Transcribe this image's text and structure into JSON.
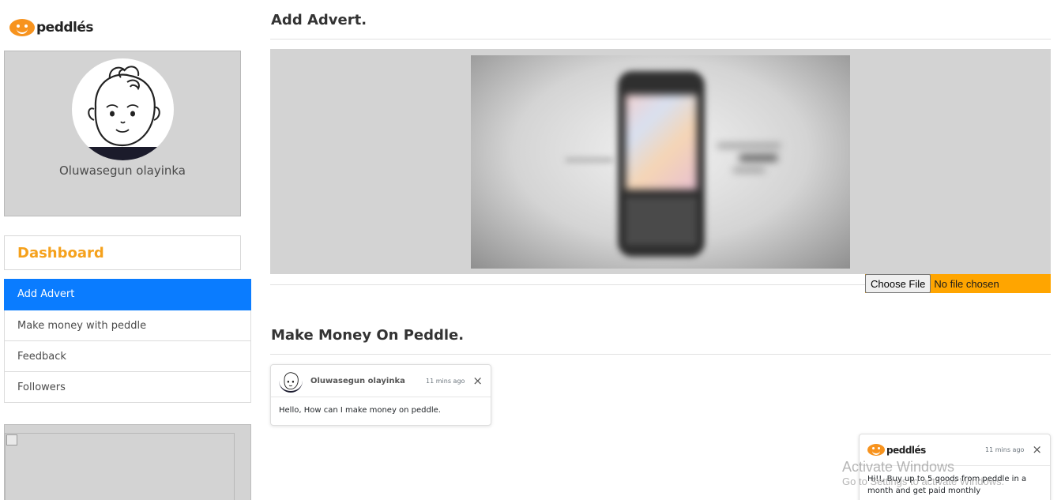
{
  "brand": {
    "logo_text": "peddlés",
    "accent": "#f5a11c",
    "active_blue": "#0a7cff"
  },
  "profile": {
    "name": "Oluwasegun olayinka"
  },
  "sidebar": {
    "dashboard_label": "Dashboard",
    "menu": [
      {
        "label": "Add Advert",
        "active": true
      },
      {
        "label": "Make money with peddle",
        "active": false
      },
      {
        "label": "Feedback",
        "active": false
      },
      {
        "label": "Followers",
        "active": false
      }
    ]
  },
  "main": {
    "add_advert_title": "Add Advert.",
    "file_input": {
      "button_label": "Choose File",
      "status": "No file chosen",
      "bar_color": "#ffa500"
    },
    "make_money_title": "Make Money On Peddle."
  },
  "toasts": [
    {
      "sender": "Oluwasegun olayinka",
      "time": "11 mins ago",
      "close": "×",
      "message": "Hello, How can I make money on peddle."
    },
    {
      "sender_logo": "peddlés",
      "time": "11 mins ago",
      "close": "×",
      "message": "Hi!!, Buy up to 5 goods from peddle in a month and get paid monthly"
    }
  ],
  "watermark": {
    "title": "Activate Windows",
    "subtitle": "Go to Settings to activate Windows."
  }
}
